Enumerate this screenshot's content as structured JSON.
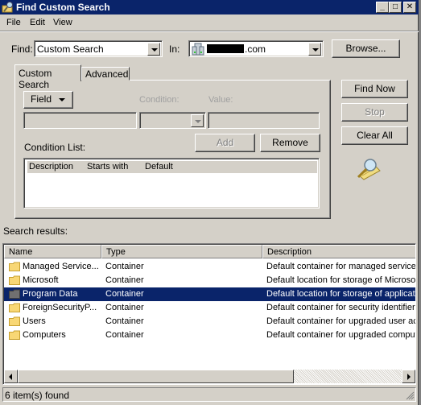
{
  "window": {
    "title": "Find Custom Search",
    "controls": {
      "minimize": "_",
      "maximize": "□",
      "close": "✕"
    }
  },
  "menu": [
    "File",
    "Edit",
    "View"
  ],
  "find": {
    "label": "Find:",
    "value": "Custom Search",
    "in_label": "In:",
    "in_value_suffix": ".com",
    "browse_label": "Browse..."
  },
  "tabs": [
    {
      "label": "Custom Search",
      "active": true
    },
    {
      "label": "Advanced",
      "active": false
    }
  ],
  "custom_search": {
    "field_button": "Field",
    "condition_label": "Condition:",
    "value_label": "Value:",
    "add_label": "Add",
    "remove_label": "Remove",
    "condition_list_label": "Condition List:",
    "condition_list_columns": [
      "Description",
      "Starts with",
      "Default"
    ]
  },
  "actions": {
    "find_now": "Find Now",
    "stop": "Stop",
    "clear_all": "Clear All"
  },
  "results": {
    "label": "Search results:",
    "columns": [
      "Name",
      "Type",
      "Description"
    ],
    "rows": [
      {
        "name": "Managed Service...",
        "type": "Container",
        "description": "Default container for managed service",
        "selected": false
      },
      {
        "name": "Microsoft",
        "type": "Container",
        "description": "Default location for storage of Microsol",
        "selected": false
      },
      {
        "name": "Program Data",
        "type": "Container",
        "description": "Default location for storage of applicat",
        "selected": true
      },
      {
        "name": "ForeignSecurityP...",
        "type": "Container",
        "description": "Default container for security identifier",
        "selected": false
      },
      {
        "name": "Users",
        "type": "Container",
        "description": "Default container for upgraded user ac",
        "selected": false
      },
      {
        "name": "Computers",
        "type": "Container",
        "description": "Default container for upgraded comput",
        "selected": false
      }
    ]
  },
  "status": {
    "text": "6 item(s) found"
  },
  "colors": {
    "titlebar": "#0a246a",
    "face": "#d4d0c8",
    "selection": "#0a246a",
    "folder": "#f8d775"
  }
}
